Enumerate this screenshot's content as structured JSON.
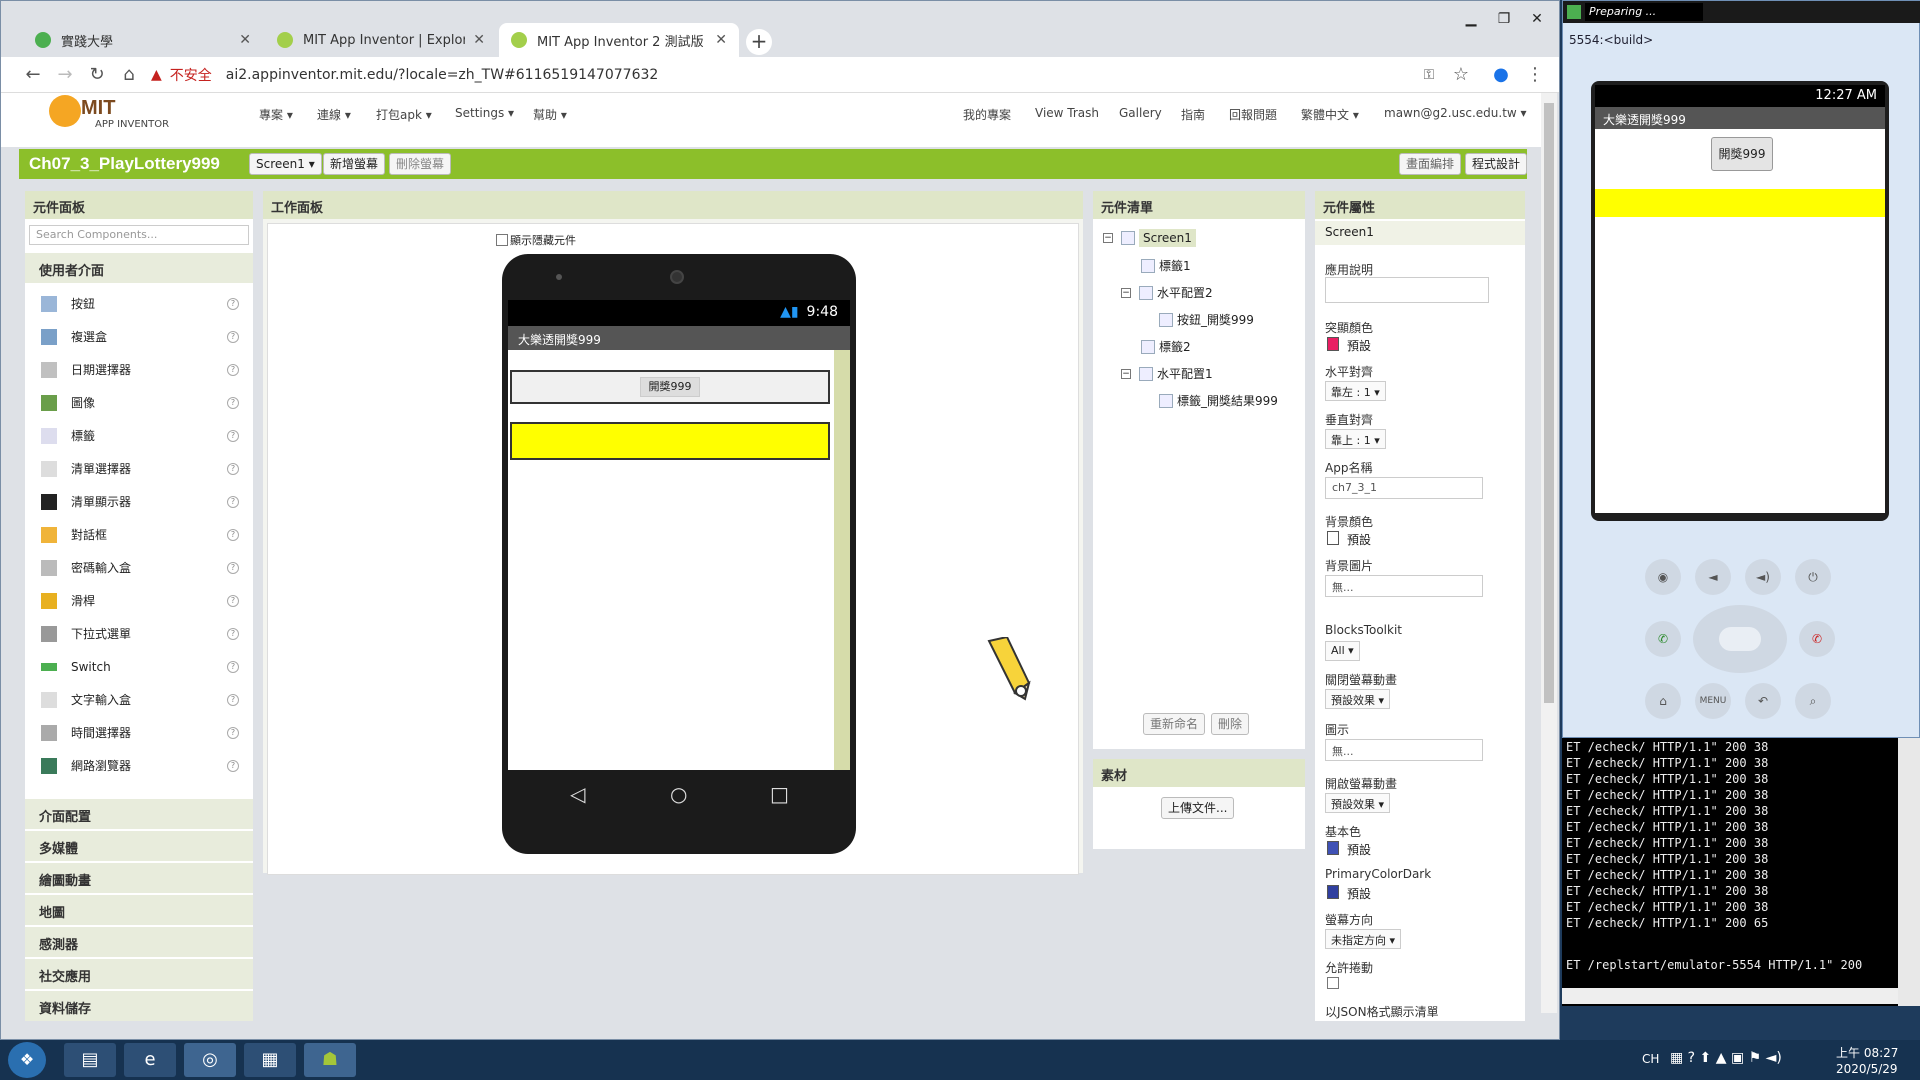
{
  "browser": {
    "tabs": [
      {
        "title": "實踐大學",
        "color": "#4caf50"
      },
      {
        "title": "MIT App Inventor | Explore MIT",
        "color": "#a3cf4b"
      },
      {
        "title": "MIT App Inventor 2 測試版",
        "color": "#a3cf4b"
      }
    ],
    "insecure_label": "不安全",
    "url": "ai2.appinventor.mit.edu/?locale=zh_TW#6116519147077632"
  },
  "ai": {
    "logo_text": "MIT",
    "logo_sub": "APP INVENTOR",
    "menu_left": [
      "專案 ▾",
      "連線 ▾",
      "打包apk ▾",
      "Settings ▾",
      "幫助 ▾"
    ],
    "menu_right": [
      "我的專案",
      "View Trash",
      "Gallery",
      "指南",
      "回報問題",
      "繁體中文 ▾",
      "mawn@g2.usc.edu.tw ▾"
    ],
    "project_name": "Ch07_3_PlayLottery999",
    "screen_select": "Screen1 ▾",
    "add_screen": "新增螢幕",
    "remove_screen": "刪除螢幕",
    "designer_btn": "畫面編排",
    "blocks_btn": "程式設計"
  },
  "palette": {
    "title": "元件面板",
    "search_placeholder": "Search Components...",
    "open_category": "使用者介面",
    "items": [
      "按鈕",
      "複選盒",
      "日期選擇器",
      "圖像",
      "標籤",
      "清單選擇器",
      "清單顯示器",
      "對話框",
      "密碼輸入盒",
      "滑桿",
      "下拉式選單",
      "Switch",
      "文字輸入盒",
      "時間選擇器",
      "網路瀏覽器"
    ],
    "categories": [
      "介面配置",
      "多媒體",
      "繪圖動畫",
      "地圖",
      "感測器",
      "社交應用",
      "資料儲存"
    ]
  },
  "viewer": {
    "title": "工作面板",
    "show_hidden": "顯示隱藏元件",
    "status_time": "9:48",
    "app_title": "大樂透開獎999",
    "button_text": "開獎999"
  },
  "tree": {
    "title": "元件清單",
    "nodes": [
      "Screen1",
      "標籤1",
      "水平配置2",
      "按鈕_開獎999",
      "標籤2",
      "水平配置1",
      "標籤_開獎結果999"
    ],
    "rename": "重新命名",
    "delete": "刪除"
  },
  "media": {
    "title": "素材",
    "upload": "上傳文件..."
  },
  "props": {
    "title": "元件屬性",
    "component": "Screen1",
    "about_label": "應用說明",
    "accent_label": "突顯顏色",
    "default": "預設",
    "halign_label": "水平對齊",
    "halign_value": "靠左 : 1 ▾",
    "valign_label": "垂直對齊",
    "valign_value": "靠上 : 1 ▾",
    "appname_label": "App名稱",
    "appname_value": "ch7_3_1",
    "bgcolor_label": "背景顏色",
    "bgimage_label": "背景圖片",
    "none": "無...",
    "blocks_label": "BlocksToolkit",
    "blocks_value": "All ▾",
    "close_anim_label": "關閉螢幕動畫",
    "anim_value": "預設效果 ▾",
    "icon_label": "圖示",
    "open_anim_label": "開啟螢幕動畫",
    "primary_label": "基本色",
    "primary_dark_label": "PrimaryColorDark",
    "orientation_label": "螢幕方向",
    "orientation_value": "未指定方向 ▾",
    "scroll_label": "允許捲動",
    "json_label": "以JSON格式顯示清單",
    "accent_color": "#e91e63",
    "primary_color": "#3f51b5"
  },
  "emulator": {
    "top_status": "Preparing ...",
    "title": "5554:<build>",
    "time": "12:27 AM",
    "app_title": "大樂透開獎999",
    "button_text": "開獎999",
    "menu_key": "MENU"
  },
  "console": {
    "repeat_line": "ET /echeck/ HTTP/1.1\" 200 38",
    "line_65": "ET /echeck/ HTTP/1.1\" 200 65",
    "last_line": "ET /replstart/emulator-5554 HTTP/1.1\" 200"
  },
  "taskbar": {
    "lang": "CH",
    "time": "上午 08:27",
    "date": "2020/5/29"
  },
  "colors": {
    "ai_green": "#8cbf2a",
    "label_yellow": "#ffff00"
  }
}
